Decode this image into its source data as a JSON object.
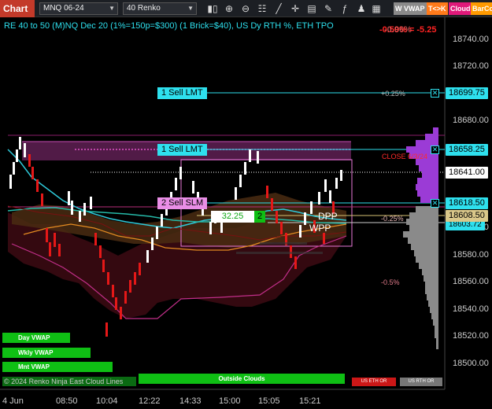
{
  "toolbar": {
    "chart_label": "Chart",
    "instrument": "MNQ 06-24",
    "bar_type": "40 Renko",
    "icons": [
      "bars-icon",
      "magnifier-plus-icon",
      "magnifier-minus-icon",
      "properties-icon",
      "drawing-icon",
      "crosshair-icon",
      "orders-icon",
      "pen-icon",
      "indicators-icon",
      "strategy-icon",
      "chart-trader-icon"
    ],
    "vwap_label": "W VWAP",
    "t_label": "T<>K",
    "cloud_label": "Cloud",
    "barcol_label": "BarCo"
  },
  "chart": {
    "title": "RE 40 to 50 (M)NQ Dec 20 (1%=150p=$300) (1 Brick=$40), US Dy RTH %, ETH TPO",
    "pnl_text": "-0.59%  = -5.25",
    "pnl_overlay": "-0.06%",
    "close_text": "CLOSE  6/3/24",
    "pct_labels": [
      {
        "text": "+0.25%"
      },
      {
        "text": "-0.25%"
      },
      {
        "text": "-0.5%"
      }
    ],
    "price_axis": [
      "18740.00",
      "18720.00",
      "18680.00",
      "18600.00",
      "18580.00",
      "18560.00",
      "18540.00",
      "18520.00",
      "18500.00"
    ],
    "tags": {
      "order1_price": "18699.75",
      "order2_price": "18658.25",
      "current_price": "18641.00",
      "order3_price": "18618.50",
      "level_price": "18608.50",
      "level2_price": "18603.72"
    },
    "orders": [
      {
        "label": "1 Sell LMT"
      },
      {
        "label": "1 Sell LMT"
      },
      {
        "label": "2 Sell SLM"
      }
    ],
    "position": {
      "pnl": "32.25",
      "qty": "2"
    },
    "dpp_label": "DPP",
    "wpp_label": "WPP",
    "time_axis": [
      "4 Jun",
      "08:50",
      "10:04",
      "12:22",
      "14:33",
      "15:00",
      "15:05",
      "15:21"
    ],
    "legend": [
      "Day VWAP",
      "Wkly VWAP",
      "Mnt VWAP"
    ],
    "outside_clouds": "Outside Clouds",
    "copyright": "© 2024 Renko Ninja East Cloud Lines",
    "us_eth_or": "US ETH OR",
    "us_rth_or": "US RTH OR"
  },
  "colors": {
    "accent": "#2ee0ee",
    "toolbar_red": "#c33a2a",
    "legend_green": "#0fbf14",
    "sell_pink": "#e98ee6",
    "profile_purple": "#9b3bd6"
  }
}
